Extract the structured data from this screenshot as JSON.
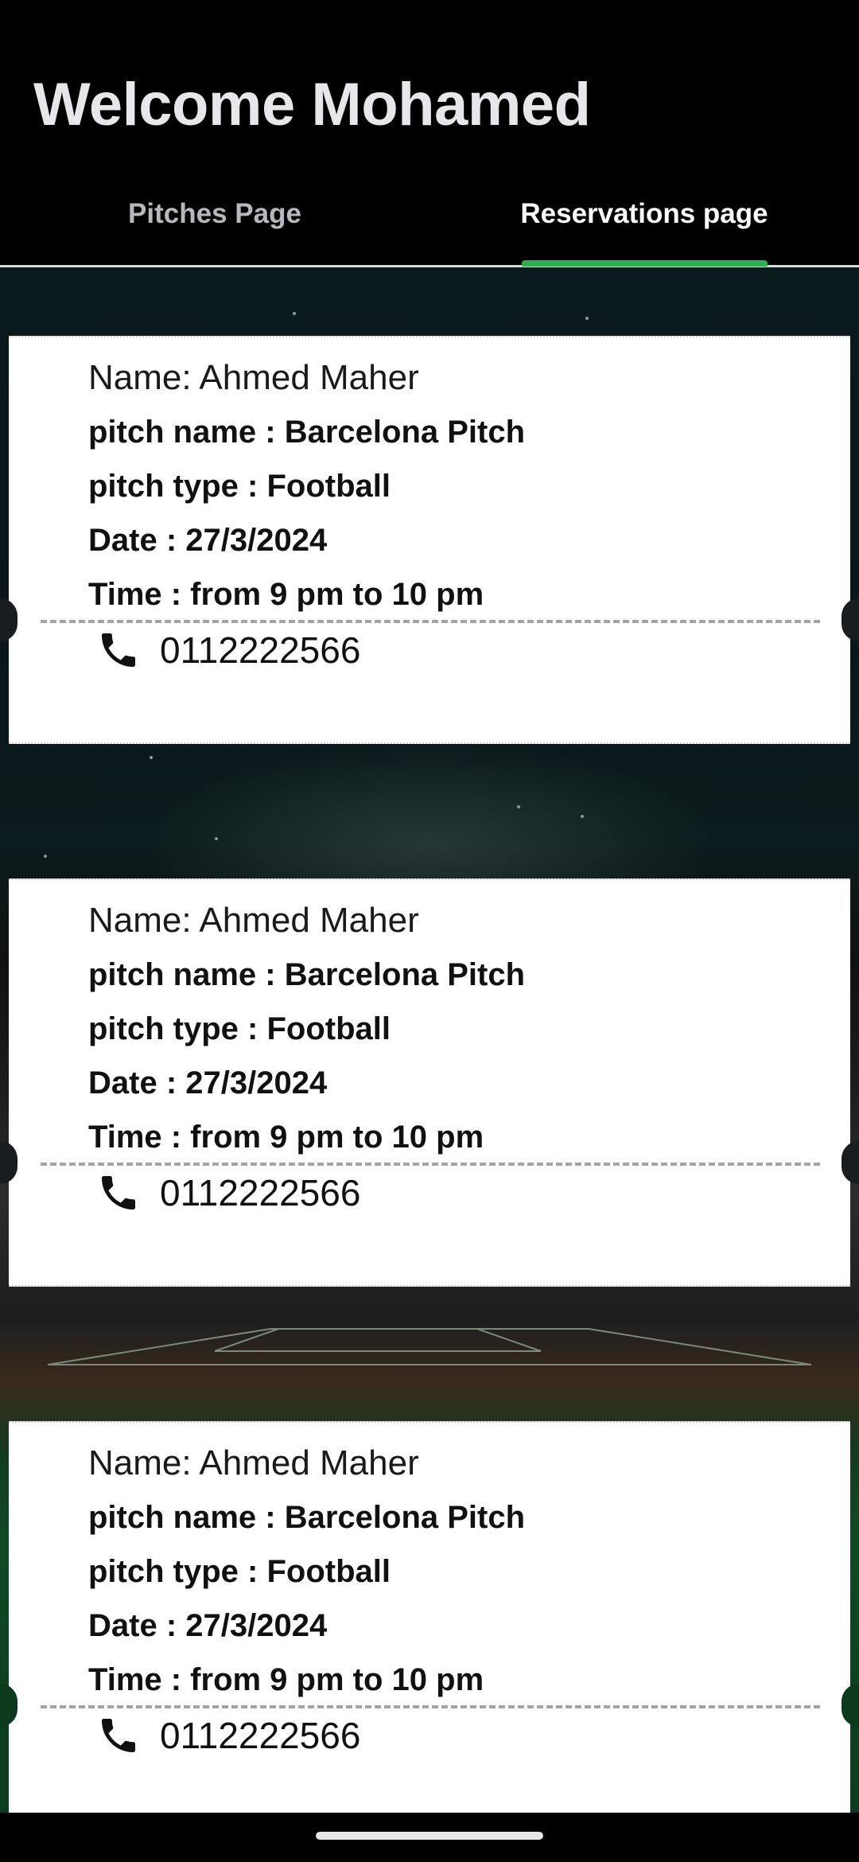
{
  "header": {
    "title": "Welcome Mohamed"
  },
  "tabs": [
    {
      "label": "Pitches Page",
      "selected": false
    },
    {
      "label": "Reservations page",
      "selected": true
    }
  ],
  "colors": {
    "accent": "#2eb04f",
    "header_bg": "#000000",
    "card_bg": "#ffffff"
  },
  "reservations": [
    {
      "name": "Name: Ahmed Maher",
      "pitch_name": "pitch name : Barcelona Pitch",
      "pitch_type": "pitch type : Football",
      "date": "Date : 27/3/2024",
      "time": "Time : from 9 pm to 10 pm",
      "phone_icon": "phone-icon",
      "phone": "0112222566"
    },
    {
      "name": "Name: Ahmed Maher",
      "pitch_name": "pitch name : Barcelona Pitch",
      "pitch_type": "pitch type : Football",
      "date": "Date : 27/3/2024",
      "time": "Time : from 9 pm to 10 pm",
      "phone_icon": "phone-icon",
      "phone": "0112222566"
    },
    {
      "name": "Name: Ahmed Maher",
      "pitch_name": "pitch name : Barcelona Pitch",
      "pitch_type": "pitch type : Football",
      "date": "Date : 27/3/2024",
      "time": "Time : from 9 pm to 10 pm",
      "phone_icon": "phone-icon",
      "phone": "0112222566"
    }
  ]
}
